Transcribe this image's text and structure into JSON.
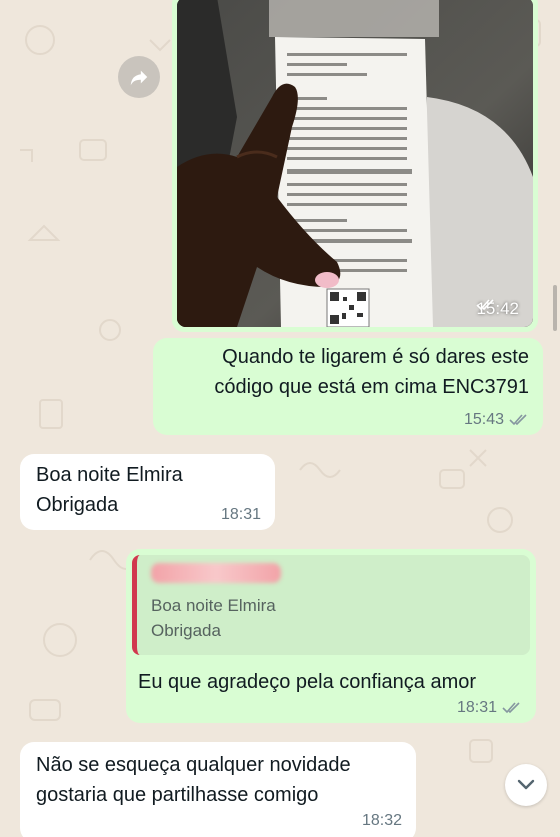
{
  "chat": {
    "messages": [
      {
        "kind": "photo",
        "direction": "outgoing",
        "time": "15:42",
        "status": "read-ticks-icon"
      },
      {
        "kind": "text",
        "direction": "outgoing",
        "text": "Quando te ligarem é só dares este\ncódigo que está em cima ENC3791",
        "time": "15:43",
        "status": "read-ticks-icon"
      },
      {
        "kind": "text",
        "direction": "incoming",
        "text": "Boa noite Elmira\nObrigada",
        "time": "18:31"
      },
      {
        "kind": "reply",
        "direction": "outgoing",
        "quoted_text": "Boa noite Elmira\nObrigada",
        "text": "Eu que agradeço pela confiança amor",
        "time": "18:31",
        "status": "read-ticks-icon"
      },
      {
        "kind": "text",
        "direction": "incoming",
        "text": "Não se esqueça qualquer novidade\ngostaria que partilhasse comigo",
        "time": "18:32"
      }
    ]
  },
  "icons": {
    "forward": "forward-arrow-icon",
    "scroll_down": "chevron-down-icon",
    "ticks": "double-check-icon"
  },
  "colors": {
    "outgoing_bubble": "#d9fdd3",
    "incoming_bubble": "#ffffff",
    "quote_bar": "#d1384e",
    "wallpaper": "#efe7dc",
    "read_ticks": "#8696a0"
  }
}
